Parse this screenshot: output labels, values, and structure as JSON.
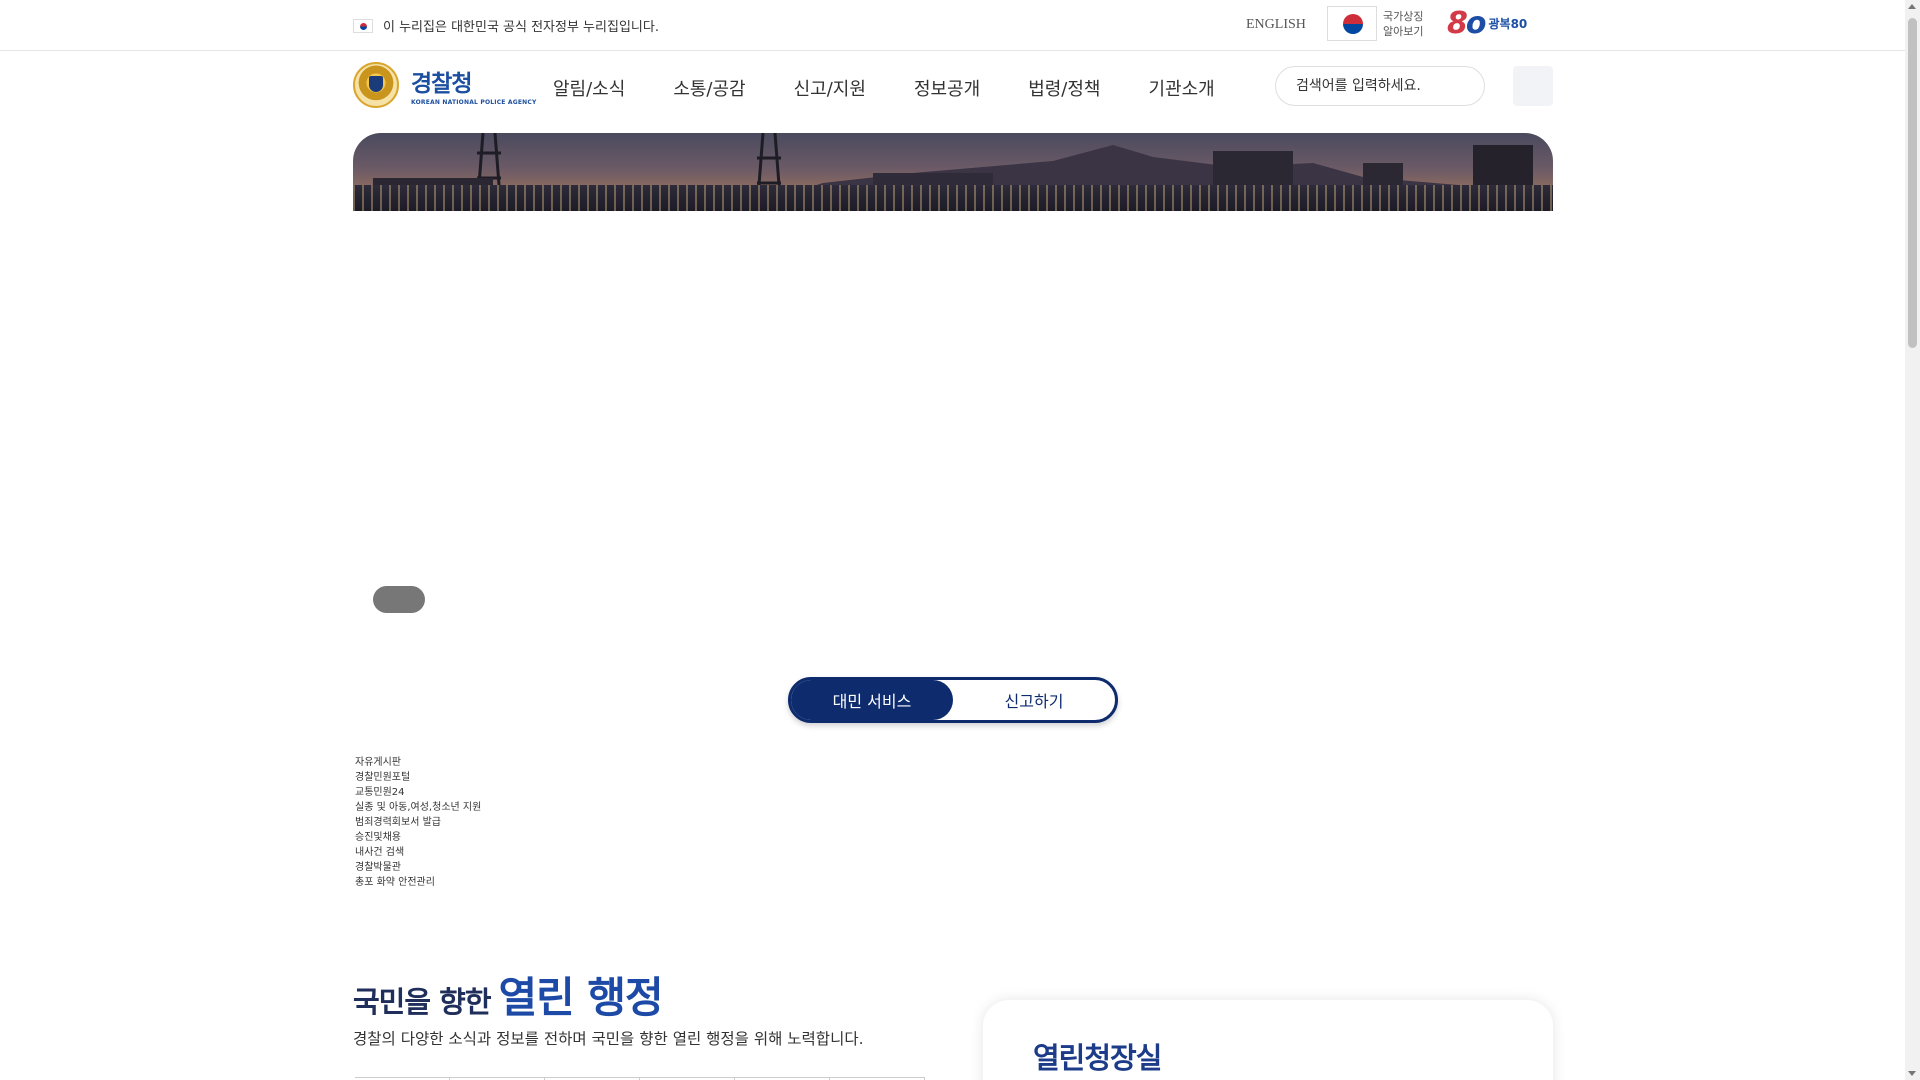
{
  "topbar": {
    "gov_notice": "이 누리집은 대한민국 공식 전자정부 누리집입니다.",
    "english": "ENGLISH",
    "national_symbol_line1": "국가상징",
    "national_symbol_line2": "알아보기",
    "gwangbok_80": "80",
    "gwangbok_label": "광복80"
  },
  "header": {
    "logo_ko": "경찰청",
    "logo_en": "KOREAN NATIONAL POLICE AGENCY",
    "nav": [
      "알림/소식",
      "소통/공감",
      "신고/지원",
      "정보공개",
      "법령/정책",
      "기관소개"
    ],
    "search_placeholder": "검색어를 입력하세요."
  },
  "toggle": {
    "civil_service": "대민 서비스",
    "report": "신고하기"
  },
  "service_links": [
    "자유게시판",
    "경찰민원포털",
    "교통민원24",
    "실종 및 아동,여성,청소년 지원",
    "범죄경력회보서 발급",
    "승진및채용",
    "내사건 검색",
    "경찰박물관",
    "총포 화약 안전관리"
  ],
  "open_admin": {
    "title_prefix": "국민을 향한",
    "title_highlight": "열린 행정",
    "description": "경찰의 다양한 소식과 정보를 전하며 국민을 향한 열린 행정을 위해 노력합니다."
  },
  "chief_room": {
    "title": "열린청장실"
  },
  "colors": {
    "primary_navy": "#0e2b6e",
    "brand_blue": "#1c4aa6"
  }
}
